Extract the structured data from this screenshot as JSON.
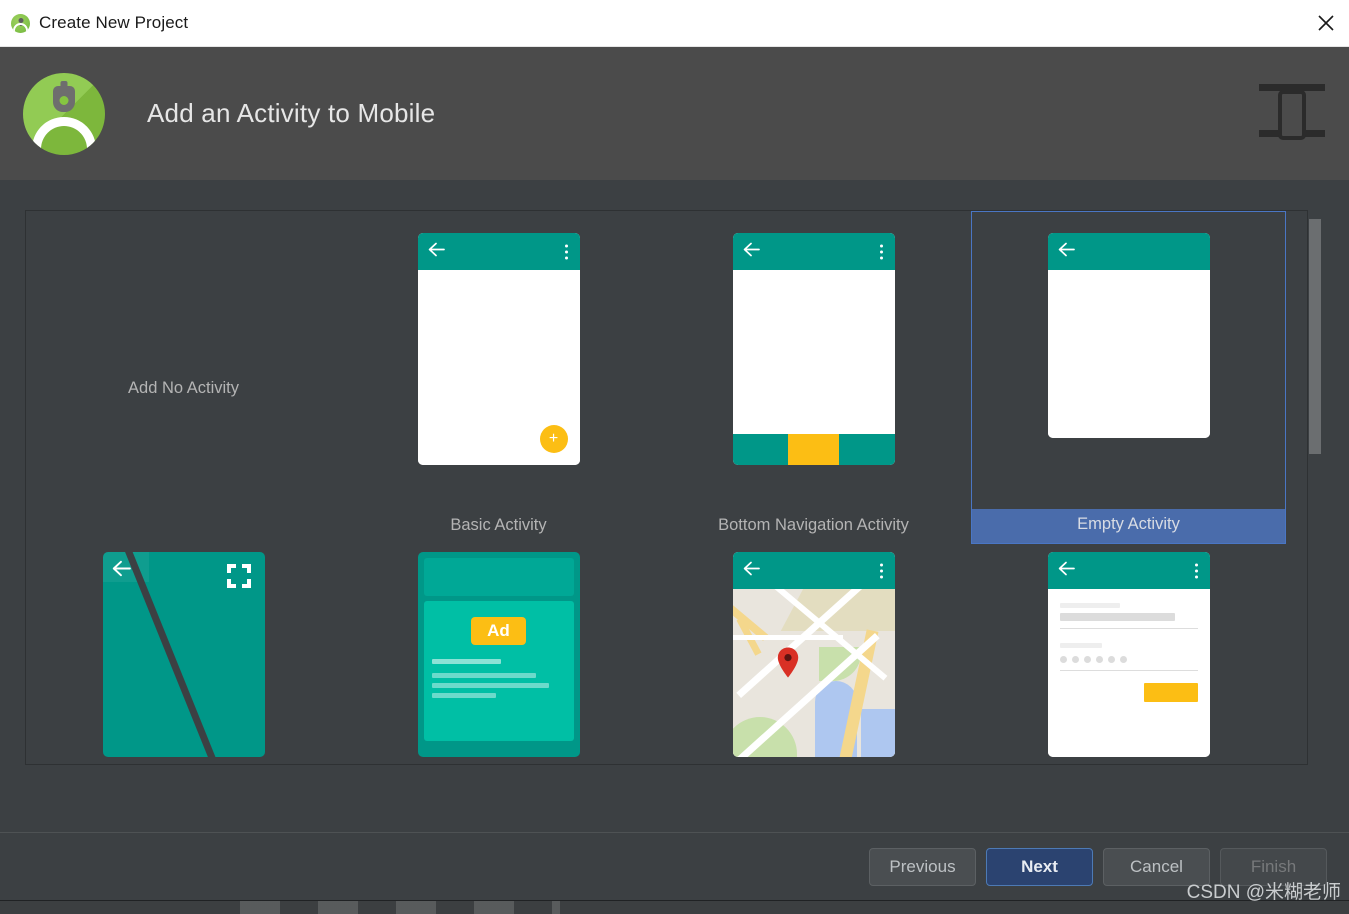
{
  "window": {
    "title": "Create New Project",
    "close_label": "×"
  },
  "header": {
    "title": "Add an Activity to Mobile",
    "logo_name": "android-studio-logo",
    "device_icon_name": "mobile-device-icon"
  },
  "templates": [
    {
      "id": "add-no-activity",
      "label": "Add No Activity",
      "thumb": "none",
      "selected": false
    },
    {
      "id": "basic-activity",
      "label": "Basic Activity",
      "thumb": "appbar-fab",
      "selected": false
    },
    {
      "id": "bottom-navigation-activity",
      "label": "Bottom Navigation Activity",
      "thumb": "appbar-bottomnav",
      "selected": false
    },
    {
      "id": "empty-activity",
      "label": "Empty Activity",
      "thumb": "appbar-plain",
      "selected": true
    },
    {
      "id": "fullscreen-activity",
      "label": "",
      "thumb": "fullscreen",
      "selected": false
    },
    {
      "id": "admob-ads-activity",
      "label": "",
      "thumb": "ad",
      "ad_badge": "Ad",
      "selected": false
    },
    {
      "id": "google-maps-activity",
      "label": "",
      "thumb": "map",
      "selected": false
    },
    {
      "id": "login-activity",
      "label": "",
      "thumb": "login",
      "selected": false
    }
  ],
  "footer": {
    "previous_label": "Previous",
    "next_label": "Next",
    "cancel_label": "Cancel",
    "finish_label": "Finish"
  },
  "watermark": {
    "text": "CSDN @米糊老师"
  },
  "colors": {
    "accent_blue": "#4a6cab",
    "selection_border": "#4a76c4",
    "material_teal": "#009788",
    "material_amber": "#fcbe14",
    "header_bg": "#4b4b4b",
    "dialog_bg": "#3c4043",
    "titlebar_bg": "#ffffff",
    "primary_button": "#2b4370"
  }
}
